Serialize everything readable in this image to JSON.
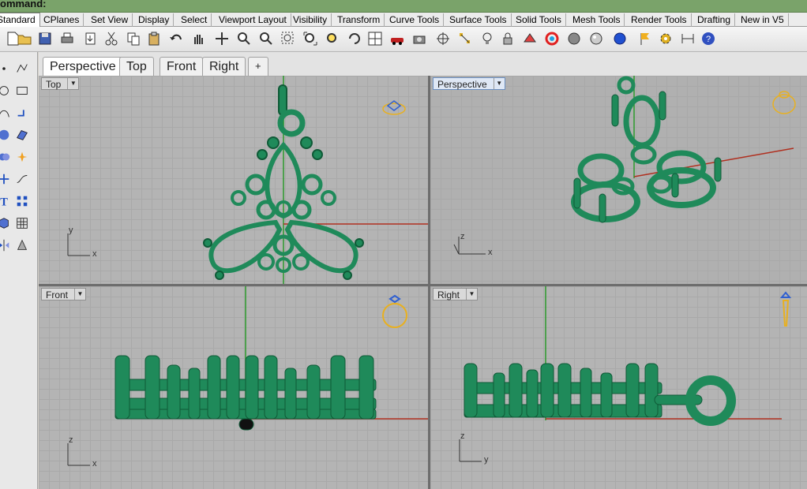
{
  "command_bar": {
    "text": "ommand:"
  },
  "toolbar_tabs": [
    {
      "label": "Standard",
      "active": true
    },
    {
      "label": "CPlanes"
    },
    {
      "label": "Set View"
    },
    {
      "label": "Display"
    },
    {
      "label": "Select"
    },
    {
      "label": "Viewport Layout"
    },
    {
      "label": "Visibility"
    },
    {
      "label": "Transform"
    },
    {
      "label": "Curve Tools"
    },
    {
      "label": "Surface Tools"
    },
    {
      "label": "Solid Tools"
    },
    {
      "label": "Mesh Tools"
    },
    {
      "label": "Render Tools"
    },
    {
      "label": "Drafting"
    },
    {
      "label": "New in V5"
    }
  ],
  "toolbar_icons": [
    "new-file-icon",
    "open-folder-icon",
    "save-icon",
    "print-icon",
    "import-icon",
    "cut-icon",
    "copy-icon",
    "paste-icon",
    "undo-icon",
    "pan-hand-icon",
    "move-view-icon",
    "zoom-in-icon",
    "zoom-out-icon",
    "zoom-window-icon",
    "zoom-extents-icon",
    "zoom-selected-icon",
    "rotate-view-icon",
    "four-viewports-icon",
    "car-icon",
    "camera-icon",
    "lock-target-icon",
    "select-points-icon",
    "light-bulb-icon",
    "lock-icon",
    "layer-color-icon",
    "color-wheel-icon",
    "shaded-sphere-icon",
    "rendered-sphere-icon",
    "blue-sphere-icon",
    "flag-icon",
    "gear-icon",
    "dimension-icon",
    "help-icon"
  ],
  "sidebar_icons": [
    "point-icon",
    "polyline-icon",
    "circle-icon",
    "rectangle-icon",
    "curve-icon",
    "extrude-icon",
    "sphere-icon",
    "surface-icon",
    "boolean-icon",
    "explode-icon",
    "trim-icon",
    "join-icon",
    "text-icon",
    "array-icon",
    "box-icon",
    "grid-icon",
    "mirror-icon",
    "cone-icon"
  ],
  "view_tabs": [
    {
      "label": "Perspective",
      "active": true
    },
    {
      "label": "Top"
    },
    {
      "label": "Front"
    },
    {
      "label": "Right"
    }
  ],
  "add_tab_label": "+",
  "viewports": {
    "top": {
      "label": "Top",
      "axis_h": "x",
      "axis_v": "y"
    },
    "perspective": {
      "label": "Perspective",
      "axis_h": "x",
      "axis_v": "z"
    },
    "front": {
      "label": "Front",
      "axis_h": "x",
      "axis_v": "z"
    },
    "right": {
      "label": "Right",
      "axis_h": "y",
      "axis_v": "z"
    }
  },
  "colors": {
    "model_green": "#1f8a5a",
    "model_dark": "#0f5a37",
    "axis_red": "#b03020",
    "axis_green": "#2c9a2c",
    "gumball_gold": "#e8b020"
  }
}
